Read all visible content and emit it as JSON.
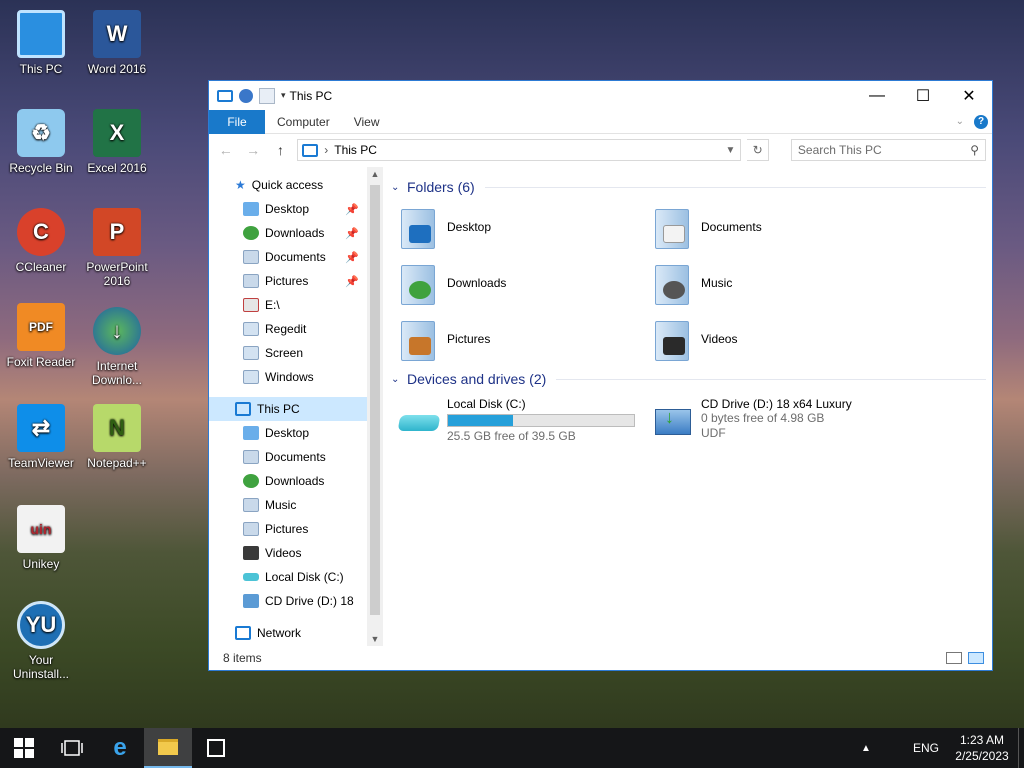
{
  "desktop": {
    "icons": [
      {
        "label": "This PC"
      },
      {
        "label": "Word 2016"
      },
      {
        "label": "Recycle Bin"
      },
      {
        "label": "Excel 2016"
      },
      {
        "label": "CCleaner"
      },
      {
        "label": "PowerPoint 2016"
      },
      {
        "label": "Foxit Reader"
      },
      {
        "label": "Internet Downlo..."
      },
      {
        "label": "TeamViewer"
      },
      {
        "label": "Notepad++"
      },
      {
        "label": "Unikey"
      },
      {
        "label": "Your Uninstall..."
      }
    ]
  },
  "window": {
    "title": "This PC",
    "ribbon": {
      "file": "File",
      "computer": "Computer",
      "view": "View",
      "help": "?"
    },
    "address": "This PC",
    "search_placeholder": "Search This PC",
    "nav": {
      "quick_access": "Quick access",
      "qa_items": [
        "Desktop",
        "Downloads",
        "Documents",
        "Pictures",
        "E:\\",
        "Regedit",
        "Screen",
        "Windows"
      ],
      "this_pc": "This PC",
      "pc_items": [
        "Desktop",
        "Documents",
        "Downloads",
        "Music",
        "Pictures",
        "Videos",
        "Local Disk (C:)",
        "CD Drive (D:) 18"
      ],
      "network": "Network"
    },
    "folders_header": "Folders (6)",
    "folders": [
      "Desktop",
      "Documents",
      "Downloads",
      "Music",
      "Pictures",
      "Videos"
    ],
    "drives_header": "Devices and drives (2)",
    "drives": [
      {
        "name": "Local Disk (C:)",
        "free": "25.5 GB free of 39.5 GB",
        "used_fraction": 0.35
      },
      {
        "name": "CD Drive (D:) 18 x64 Luxury",
        "free": "0 bytes free of 4.98 GB",
        "fs": "UDF"
      }
    ],
    "status": "8 items"
  },
  "taskbar": {
    "language": "ENG",
    "time": "1:23 AM",
    "date": "2/25/2023"
  },
  "colors": {
    "accent": "#1979ca",
    "selection": "#cce8ff",
    "group_header": "#1e3287",
    "drive_bar": "#26a0da"
  }
}
